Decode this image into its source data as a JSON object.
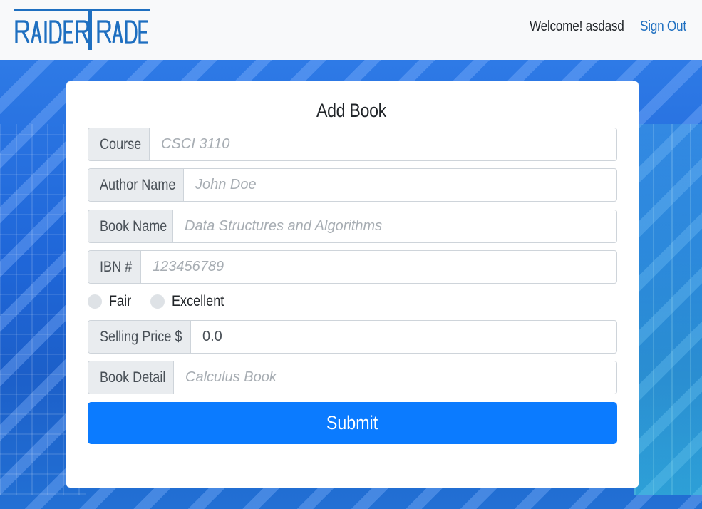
{
  "header": {
    "logo_text": "RAIDER TRADE",
    "welcome": "Welcome! asdasd",
    "sign_out": "Sign Out",
    "link_color": "#1e6fc0"
  },
  "form": {
    "title": "Add Book",
    "fields": [
      {
        "label": "Course",
        "placeholder": "CSCI 3110",
        "value": ""
      },
      {
        "label": "Author Name",
        "placeholder": "John Doe",
        "value": ""
      },
      {
        "label": "Book Name",
        "placeholder": "Data Structures and Algorithms",
        "value": ""
      },
      {
        "label": "IBN #",
        "placeholder": "123456789",
        "value": ""
      }
    ],
    "condition_options": [
      "Fair",
      "Excellent"
    ],
    "price": {
      "label": "Selling Price $",
      "value": "0.0"
    },
    "detail": {
      "label": "Book Detail",
      "placeholder": "Calculus Book",
      "value": ""
    },
    "submit_label": "Submit",
    "submit_color": "#0b7bff"
  }
}
